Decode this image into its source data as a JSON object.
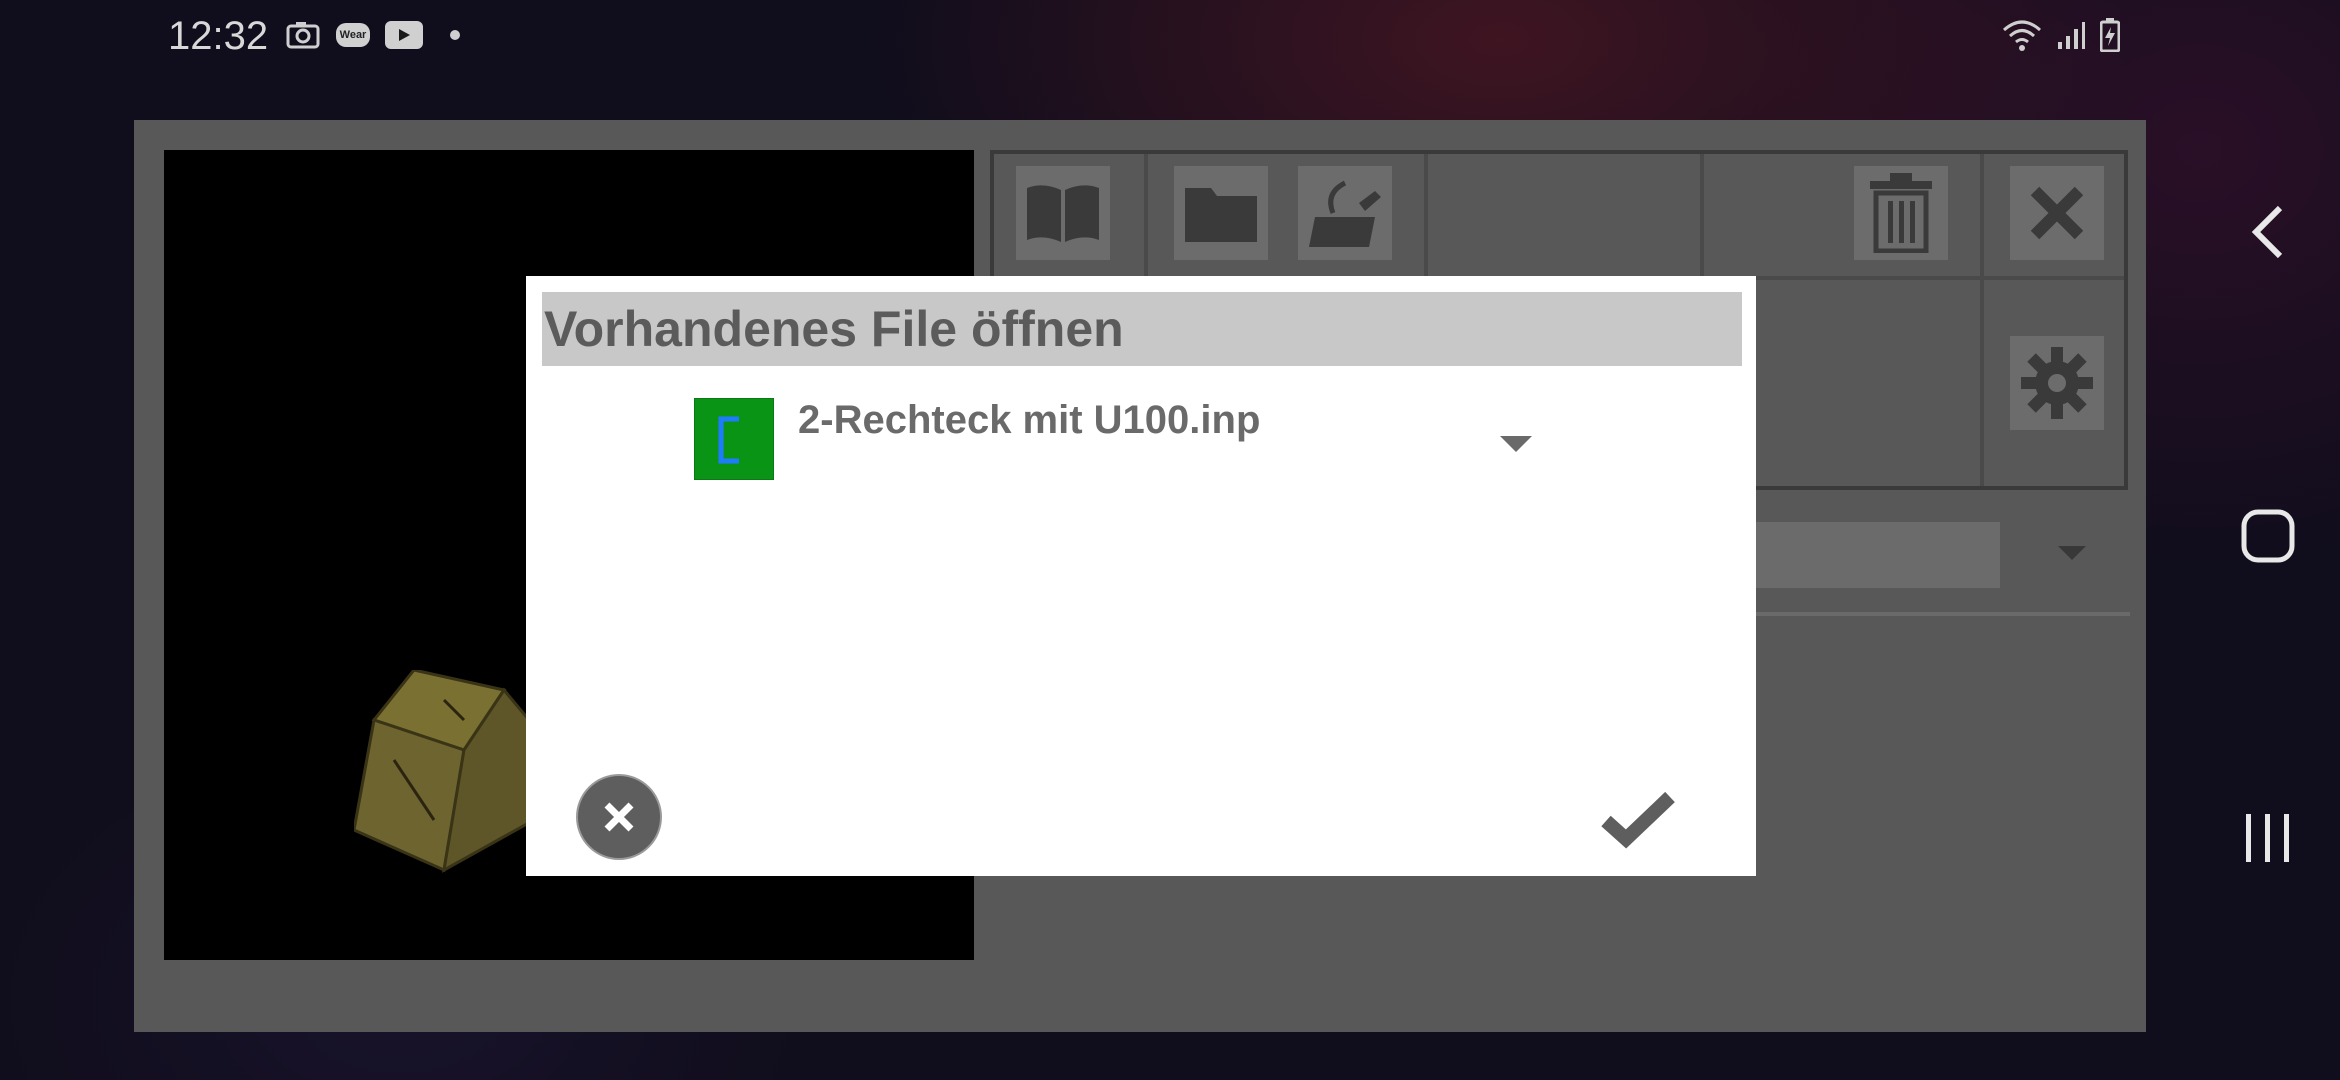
{
  "status_bar": {
    "time": "12:32",
    "icons": [
      "screenshot-icon",
      "wear-icon",
      "youtube-icon",
      "notification-dot-icon"
    ],
    "wear_text": "Wear",
    "right_icons": [
      "wifi-icon",
      "signal-icon",
      "battery-charging-icon"
    ]
  },
  "nav_bar": {
    "buttons": [
      "back",
      "home",
      "recents"
    ]
  },
  "toolbar": {
    "buttons": [
      "manual",
      "open-folder",
      "edit",
      "delete",
      "close",
      "settings"
    ]
  },
  "dialog": {
    "title": "Vorhandenes File öffnen",
    "file": {
      "name": "2-Rechteck mit U100.inp",
      "thumb_color": "#0a9416",
      "shape_color": "#1e7bff"
    },
    "cancel_icon": "close-circle-icon",
    "confirm_icon": "checkmark-icon"
  },
  "colors": {
    "dialog_title_bg": "#c8c8c8",
    "app_bg": "#585858"
  }
}
